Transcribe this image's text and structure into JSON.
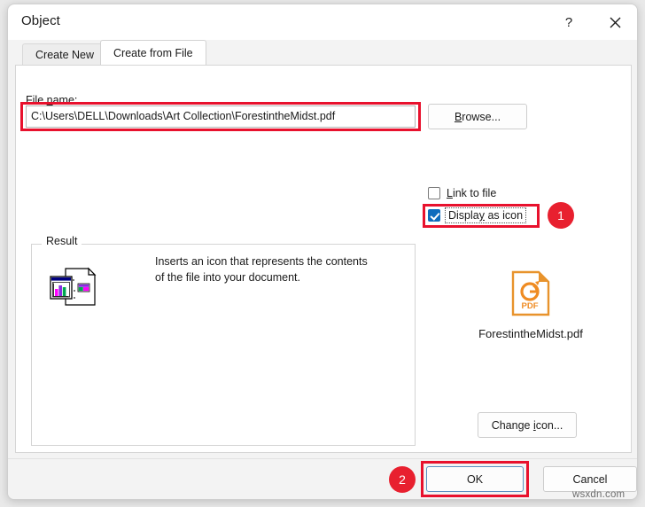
{
  "window": {
    "title": "Object",
    "help_icon": "question-mark-icon",
    "help_label": "?",
    "close_icon": "close-icon"
  },
  "tabs": [
    {
      "label": "Create New",
      "active": false
    },
    {
      "label": "Create from File",
      "active": true
    }
  ],
  "file_section": {
    "label": "File name:",
    "label_prefix": "File ",
    "label_accel": "n",
    "label_suffix": "ame:",
    "value": "C:\\Users\\DELL\\Downloads\\Art Collection\\ForestintheMidst.pdf",
    "placeholder": "",
    "browse_prefix": "",
    "browse_accel": "B",
    "browse_suffix": "rowse...",
    "browse_label": "Browse..."
  },
  "options": {
    "link_to_file": {
      "label": "Link to file",
      "accel": "L",
      "suffix": "ink to file",
      "checked": false
    },
    "display_as_icon": {
      "label": "Display as icon",
      "prefix": "Displa",
      "accel": "y",
      "suffix": " as icon",
      "checked": true
    }
  },
  "result": {
    "legend": "Result",
    "description": "Inserts an icon that represents the contents of the file into your document.",
    "icon_name": "document-with-chart-icon"
  },
  "preview": {
    "icon_name": "foxit-pdf-file-icon",
    "icon_badge_text": "PDF",
    "file_name": "ForestintheMidst.pdf",
    "change_icon_prefix": "Change ",
    "change_icon_accel": "i",
    "change_icon_suffix": "con...",
    "change_icon_label": "Change icon..."
  },
  "footer": {
    "ok_label": "OK",
    "cancel_label": "Cancel"
  },
  "annotations": {
    "badge_one": "1",
    "badge_two": "2",
    "highlight_color": "#e8112d",
    "badge_color": "#e8202f"
  },
  "watermark": "wsxdn.com"
}
